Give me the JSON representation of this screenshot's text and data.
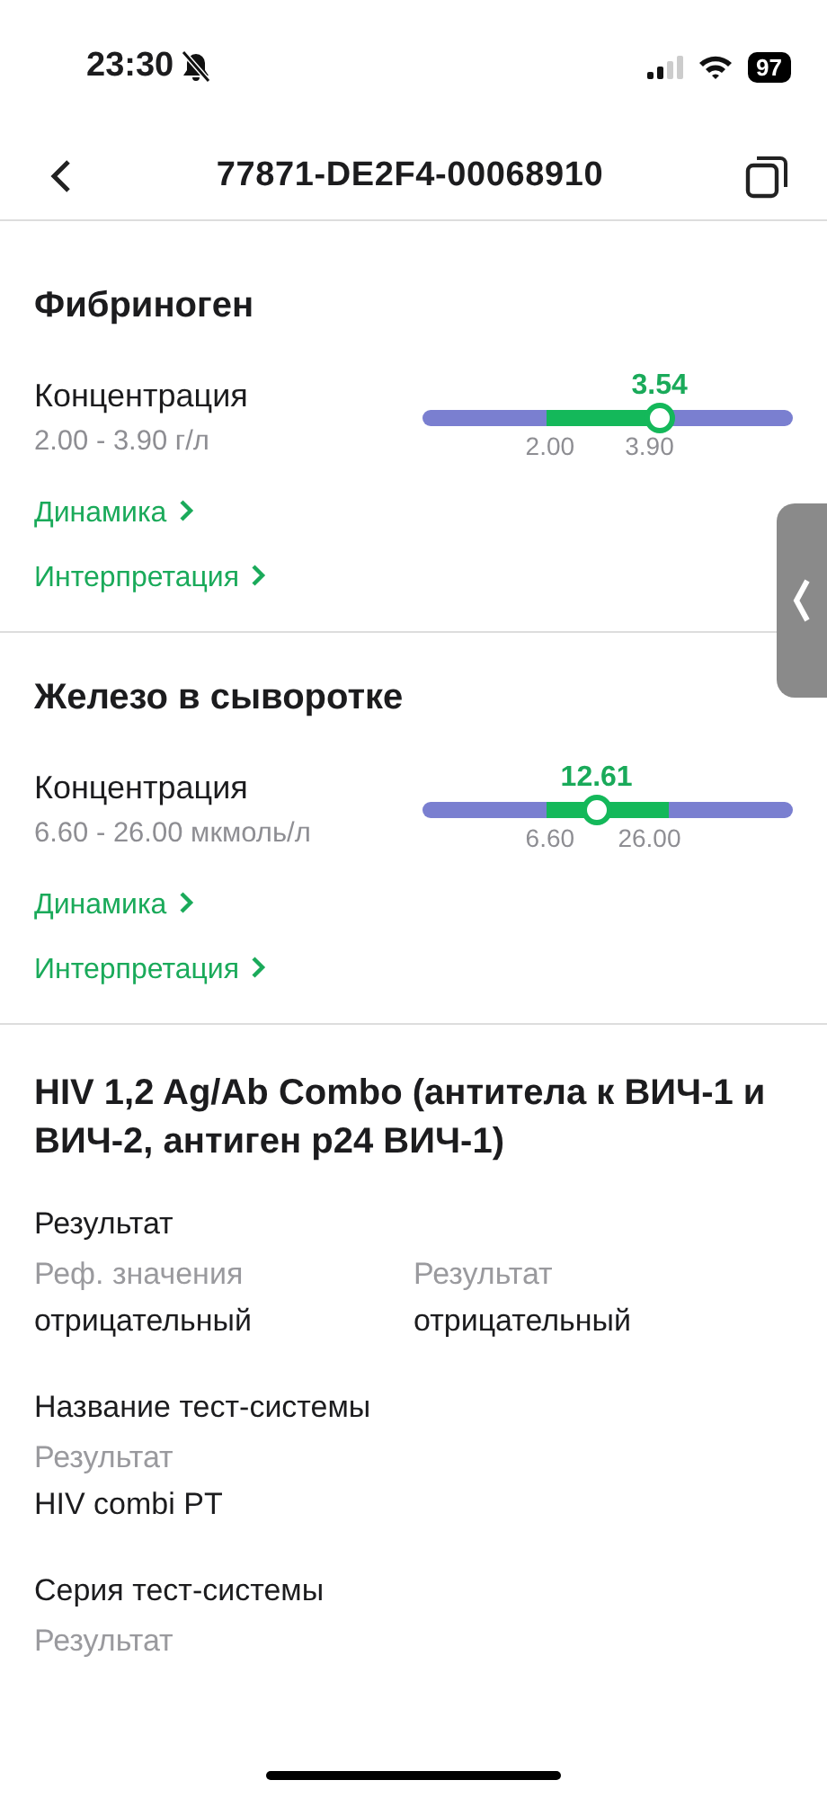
{
  "status_bar": {
    "time": "23:30",
    "battery": "97"
  },
  "header": {
    "title": "77871-DE2F4-00068910"
  },
  "sections": [
    {
      "kind": "range",
      "title": "Фибриноген",
      "parameter": "Концентрация",
      "reference": "2.00 - 3.90 г/л",
      "value": "3.54",
      "level": 0.64,
      "low": "2.00",
      "high": "3.90",
      "links": [
        "Динамика",
        "Интерпретация"
      ]
    },
    {
      "kind": "range",
      "title": "Железо в сыворотке",
      "parameter": "Концентрация",
      "reference": "6.60 - 26.00 мкмоль/л",
      "value": "12.61",
      "level": 0.47,
      "low": "6.60",
      "high": "26.00",
      "links": [
        "Динамика",
        "Интерпретация"
      ]
    },
    {
      "kind": "result",
      "title": "HIV 1,2 Ag/Ab Combo (антитела к ВИЧ-1 и ВИЧ-2, антиген p24 ВИЧ-1)",
      "groups": [
        {
          "title": "Результат",
          "fields": [
            {
              "label": "Реф. значения",
              "value": "отрицательный"
            },
            {
              "label": "Результат",
              "value": "отрицательный"
            }
          ]
        },
        {
          "title": "Название тест-системы",
          "fields": [
            {
              "label": "Результат",
              "value": "HIV combi PT"
            }
          ]
        },
        {
          "title": "Серия тест-системы",
          "fields": [
            {
              "label": "Результат"
            }
          ]
        }
      ]
    }
  ]
}
